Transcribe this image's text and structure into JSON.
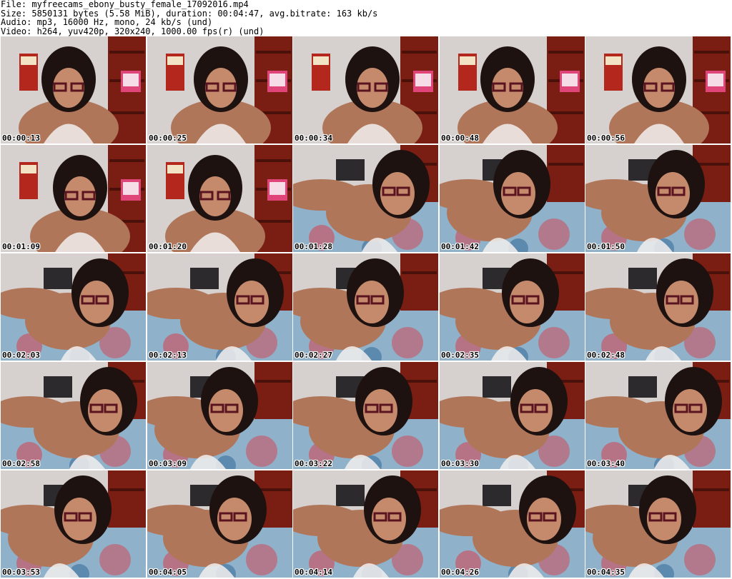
{
  "header": {
    "file_line": "File: myfreecams_ebony_busty_female_17092016.mp4",
    "size_line": "Size: 5850131 bytes (5.58 MiB), duration: 00:04:47, avg.bitrate: 163 kb/s",
    "audio_line": "Audio: mp3, 16000 Hz, mono, 24 kb/s (und)",
    "video_line": "Video: h264, yuv420p, 320x240, 1000.00 fps(r) (und)"
  },
  "frames": [
    {
      "time": "00:00:13",
      "scene": "sitting"
    },
    {
      "time": "00:00:25",
      "scene": "sitting"
    },
    {
      "time": "00:00:34",
      "scene": "sitting"
    },
    {
      "time": "00:00:48",
      "scene": "sitting"
    },
    {
      "time": "00:00:56",
      "scene": "sitting"
    },
    {
      "time": "00:01:09",
      "scene": "sitting"
    },
    {
      "time": "00:01:20",
      "scene": "sitting"
    },
    {
      "time": "00:01:28",
      "scene": "lying"
    },
    {
      "time": "00:01:42",
      "scene": "lying"
    },
    {
      "time": "00:01:50",
      "scene": "lying"
    },
    {
      "time": "00:02:03",
      "scene": "lying"
    },
    {
      "time": "00:02:13",
      "scene": "lying"
    },
    {
      "time": "00:02:27",
      "scene": "lying"
    },
    {
      "time": "00:02:35",
      "scene": "lying"
    },
    {
      "time": "00:02:48",
      "scene": "lying"
    },
    {
      "time": "00:02:58",
      "scene": "lying"
    },
    {
      "time": "00:03:09",
      "scene": "lying"
    },
    {
      "time": "00:03:22",
      "scene": "lying"
    },
    {
      "time": "00:03:30",
      "scene": "lying"
    },
    {
      "time": "00:03:40",
      "scene": "lying"
    },
    {
      "time": "00:03:53",
      "scene": "lying"
    },
    {
      "time": "00:04:05",
      "scene": "lying"
    },
    {
      "time": "00:04:14",
      "scene": "lying"
    },
    {
      "time": "00:04:26",
      "scene": "lying"
    },
    {
      "time": "00:04:35",
      "scene": "lying"
    }
  ],
  "colors": {
    "page_background": "#ffffff",
    "text": "#000000",
    "wall": "#d6d1ce",
    "shelf": "#7a1e14",
    "skin": "#b0765a",
    "hair": "#1d1210",
    "bedspread": "#8fb1c9",
    "top": "#f2f0ee",
    "glasses": "#5a1420"
  }
}
